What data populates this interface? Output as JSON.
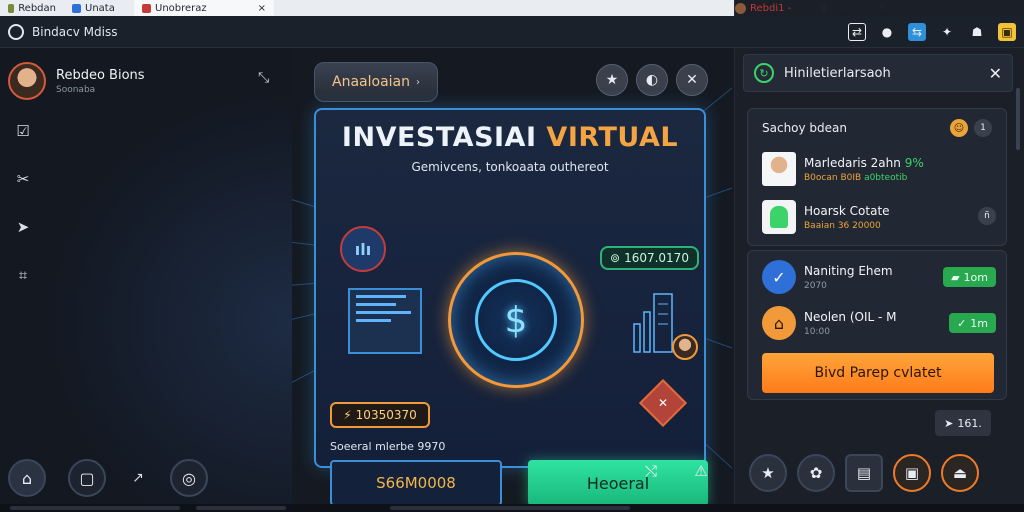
{
  "tabs": [
    {
      "label": "Rebdan",
      "color": "#7a8a3a"
    },
    {
      "label": "Unata",
      "color": "#2f6fd8"
    },
    {
      "label": "Unobreraz",
      "color": "#c43b3b",
      "close": "×"
    }
  ],
  "titlebar": {
    "profile_label": "Rebdi1 -",
    "minimize": "—",
    "maximize": "☐",
    "close": "✕"
  },
  "toolbar": {
    "title": "Bindacv Mdiss"
  },
  "sidebar": {
    "user_name": "Rebdeo Bions",
    "user_sub": "Soonaba",
    "items": [
      "item1",
      "item2",
      "item3",
      "item4"
    ]
  },
  "center": {
    "dropdown_label": "Anaaloaian",
    "headline_1": "INVESTASIAI",
    "headline_2": "VIRTUAL",
    "subline": "Gemivcens, tonkoaata outhereot",
    "value_tag": "1607.0170",
    "orange_tag": "10350370",
    "note": "Soeeral mlerbe 9970",
    "amount_button": "S66M0008",
    "confirm_button": "Heoeral"
  },
  "right_panel": {
    "header": "Hiniletierlarsaoh",
    "section_title": "Sachoy bdean",
    "contacts": [
      {
        "name": "Marledaris 2ahn",
        "pct": "9%",
        "sub_1": "B0ocan",
        "sub_2": "B0IB",
        "sub_3": "a0bteotib"
      },
      {
        "name": "Hoarsk Cotate",
        "sub_1": "Baaian",
        "sub_2": "36 20000"
      }
    ],
    "items": [
      {
        "name": "Naniting Ehem",
        "sub": "2070",
        "chip": "1om"
      },
      {
        "name": "Neolen (OIL - M",
        "sub": "10:00",
        "chip": "1m"
      }
    ],
    "action_button": "Bivd Parep cvlatet",
    "small_button": "161.",
    "count_badge": "1"
  }
}
